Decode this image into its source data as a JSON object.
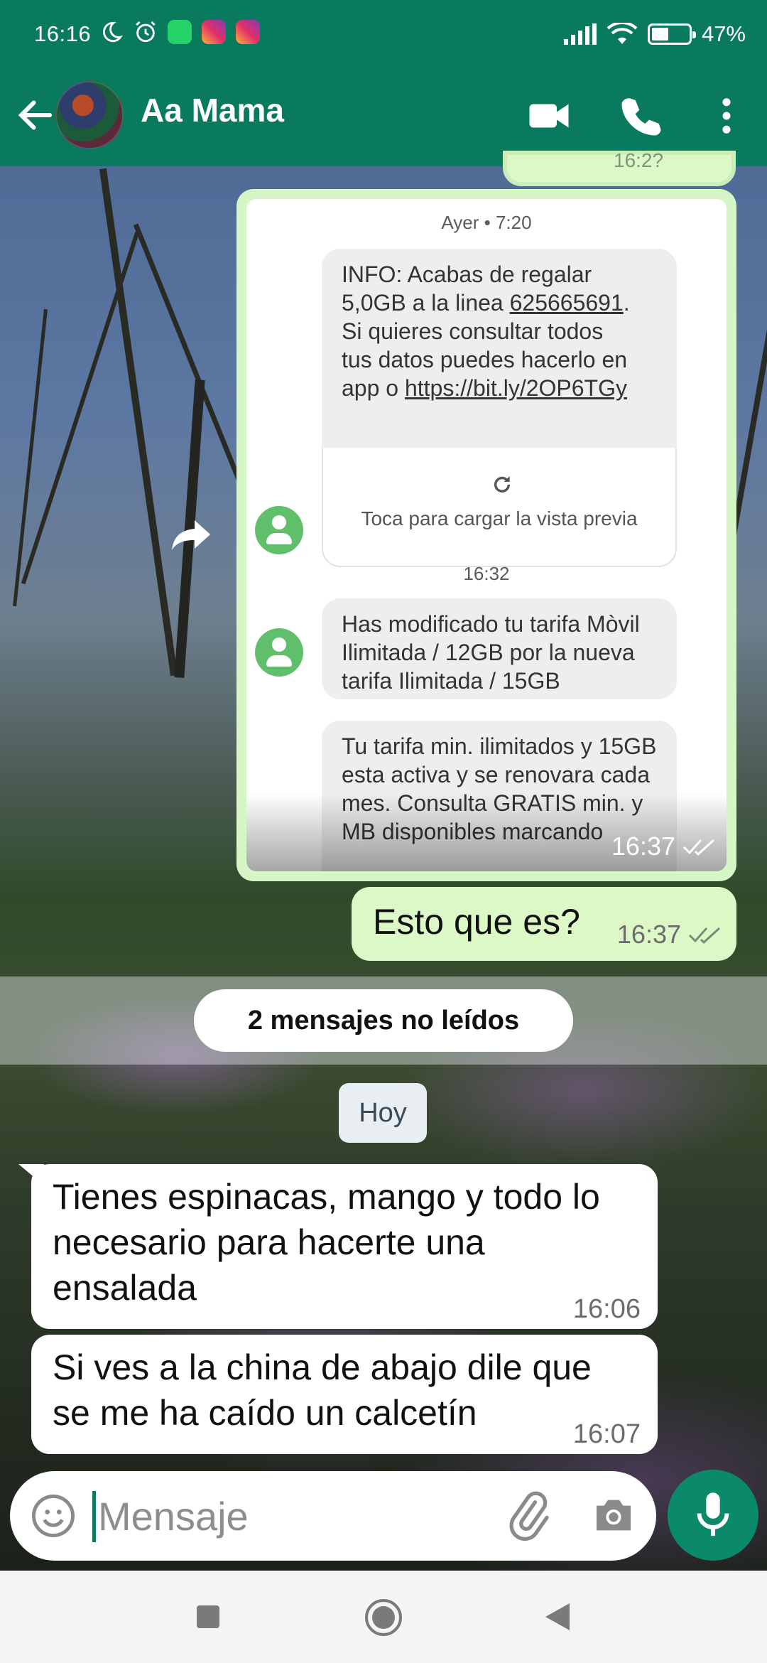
{
  "status_bar": {
    "time": "16:16",
    "battery_text": "47%",
    "battery_level": 0.47
  },
  "header": {
    "contact_name": "Aa Mama"
  },
  "previous_bubble": {
    "time": "16:2?"
  },
  "forwarded_screenshot": {
    "date_1": "Ayer • 7:20",
    "sms_1_lines": [
      "INFO: Acabas de regalar",
      "5,0GB a la linea ",
      "625665691",
      ".",
      "Si quieres consultar todos",
      "tus datos puedes hacerlo en",
      "app o ",
      "https://bit.ly/2OP6TGy"
    ],
    "preview_text": "Toca para cargar la vista previa",
    "date_2": "16:32",
    "sms_2": "Has modificado tu tarifa Mòvil Ilimitada / 12GB por la nueva tarifa Ilimitada / 15GB",
    "sms_3": "Tu tarifa min. ilimitados y 15GB esta activa y se renovara cada mes. Consulta GRATIS min. y MB disponibles marcando",
    "time": "16:37"
  },
  "messages": {
    "outgoing_1": {
      "text": "Esto que es?",
      "time": "16:37"
    },
    "unread_banner": "2 mensajes no leídos",
    "day_label": "Hoy",
    "incoming_1": {
      "text": "Tienes espinacas, mango y todo lo necesario para hacerte una ensalada",
      "time": "16:06"
    },
    "incoming_2": {
      "text": "Si ves a la china de abajo dile que se me ha caído un calcetín",
      "time": "16:07"
    }
  },
  "composer": {
    "placeholder": "Mensaje"
  },
  "colors": {
    "header": "#0a7a5e",
    "outgoing_bubble": "#dcf8c6",
    "incoming_bubble": "#ffffff",
    "mic_button": "#0b8a6b"
  }
}
